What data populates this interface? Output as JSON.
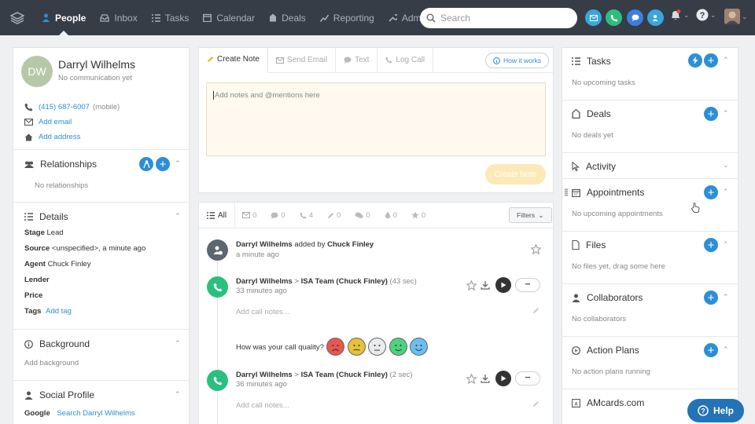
{
  "nav": {
    "items": [
      {
        "label": "People",
        "icon": "person-icon"
      },
      {
        "label": "Inbox",
        "icon": "inbox-icon"
      },
      {
        "label": "Tasks",
        "icon": "tasks-icon"
      },
      {
        "label": "Calendar",
        "icon": "calendar-icon"
      },
      {
        "label": "Deals",
        "icon": "deals-icon"
      },
      {
        "label": "Reporting",
        "icon": "reporting-icon"
      },
      {
        "label": "Admin",
        "icon": "admin-icon"
      }
    ],
    "search_placeholder": "Search"
  },
  "contact": {
    "initials": "DW",
    "name": "Darryl Wilhelms",
    "subtitle": "No communication yet",
    "phone": "(415) 687-6007",
    "phone_type": "(mobile)",
    "add_email": "Add email",
    "add_address": "Add address"
  },
  "relationships": {
    "title": "Relationships",
    "empty": "No relationships"
  },
  "details": {
    "title": "Details",
    "rows": [
      {
        "label": "Stage",
        "value": "Lead"
      },
      {
        "label": "Source",
        "value": "<unspecified>, a minute ago"
      },
      {
        "label": "Agent",
        "value": "Chuck Finley"
      },
      {
        "label": "Lender",
        "value": ""
      },
      {
        "label": "Price",
        "value": ""
      },
      {
        "label": "Tags",
        "value": "Add tag"
      }
    ]
  },
  "background": {
    "title": "Background",
    "placeholder": "Add background"
  },
  "social": {
    "title": "Social Profile",
    "label": "Google",
    "link": "Search Darryl Wilhelms"
  },
  "composer": {
    "tabs": [
      "Create Note",
      "Send Email",
      "Text",
      "Log Call"
    ],
    "how_it_works": "How it works",
    "placeholder": "Add notes and @mentions here",
    "button": "Create Note"
  },
  "feed": {
    "filters": [
      {
        "label": "All"
      },
      {
        "label": "0"
      },
      {
        "label": "0"
      },
      {
        "label": "4"
      },
      {
        "label": "0"
      },
      {
        "label": "0"
      },
      {
        "label": "0"
      },
      {
        "label": "0"
      }
    ],
    "filters_button": "Filters",
    "item1": {
      "name": "Darryl Wilhelms",
      "mid": "added by",
      "by": "Chuck Finley",
      "time": "a minute ago"
    },
    "item2": {
      "name": "Darryl Wilhelms",
      "arrow": ">",
      "team": "ISA Team (Chuck Finley)",
      "dur": "(43 sec)",
      "time": "33 minutes ago",
      "notes": "Add call notes..."
    },
    "quality": "How was your call quality?",
    "item3": {
      "name": "Darryl Wilhelms",
      "arrow": ">",
      "team": "ISA Team (Chuck Finley)",
      "dur": "(2 sec)",
      "time": "36 minutes ago",
      "notes": "Add call notes..."
    },
    "more": "•••"
  },
  "right": {
    "tasks": {
      "title": "Tasks",
      "empty": "No upcoming tasks"
    },
    "deals": {
      "title": "Deals",
      "empty": "No deals yet"
    },
    "activity": {
      "title": "Activity"
    },
    "appointments": {
      "title": "Appointments",
      "empty": "No upcoming appointments"
    },
    "files": {
      "title": "Files",
      "empty": "No files yet, drag some here"
    },
    "collaborators": {
      "title": "Collaborators",
      "empty": "No collaborators"
    },
    "action_plans": {
      "title": "Action Plans",
      "empty": "No action plans running"
    },
    "amcards": {
      "title": "AMcards.com"
    }
  },
  "help": "Help",
  "colors": {
    "nav": "#363d47",
    "accent": "#2c8fd6",
    "call_green": "#2bbf7e",
    "create_button": "#fde9b8"
  }
}
